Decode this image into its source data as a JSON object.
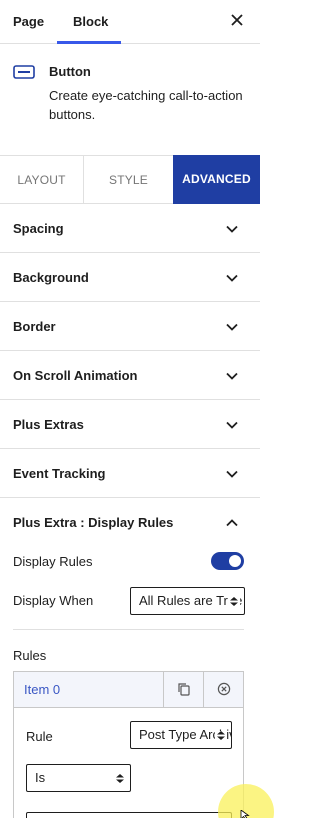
{
  "sidebar_tabs": {
    "page": "Page",
    "block": "Block"
  },
  "block": {
    "name": "Button",
    "description": "Create eye-catching call-to-action buttons.",
    "icon": "button-block-icon"
  },
  "settings_tabs": {
    "layout": "LAYOUT",
    "style": "STYLE",
    "advanced": "ADVANCED"
  },
  "panels": [
    {
      "label": "Spacing"
    },
    {
      "label": "Background"
    },
    {
      "label": "Border"
    },
    {
      "label": "On Scroll Animation"
    },
    {
      "label": "Plus Extras"
    },
    {
      "label": "Event Tracking"
    }
  ],
  "display_rules": {
    "title": "Plus Extra : Display Rules",
    "display_rules_label": "Display Rules",
    "display_rules_enabled": true,
    "display_when_label": "Display When",
    "display_when_value": "All Rules are True",
    "rules_label": "Rules",
    "item": {
      "title": "Item 0",
      "rule_label": "Rule",
      "rule_value": "Post Type Archive",
      "operator_value": "Is"
    }
  },
  "colors": {
    "accent": "#1f3ea3",
    "link": "#3a57c4",
    "tab_indicator": "#3858e9"
  }
}
